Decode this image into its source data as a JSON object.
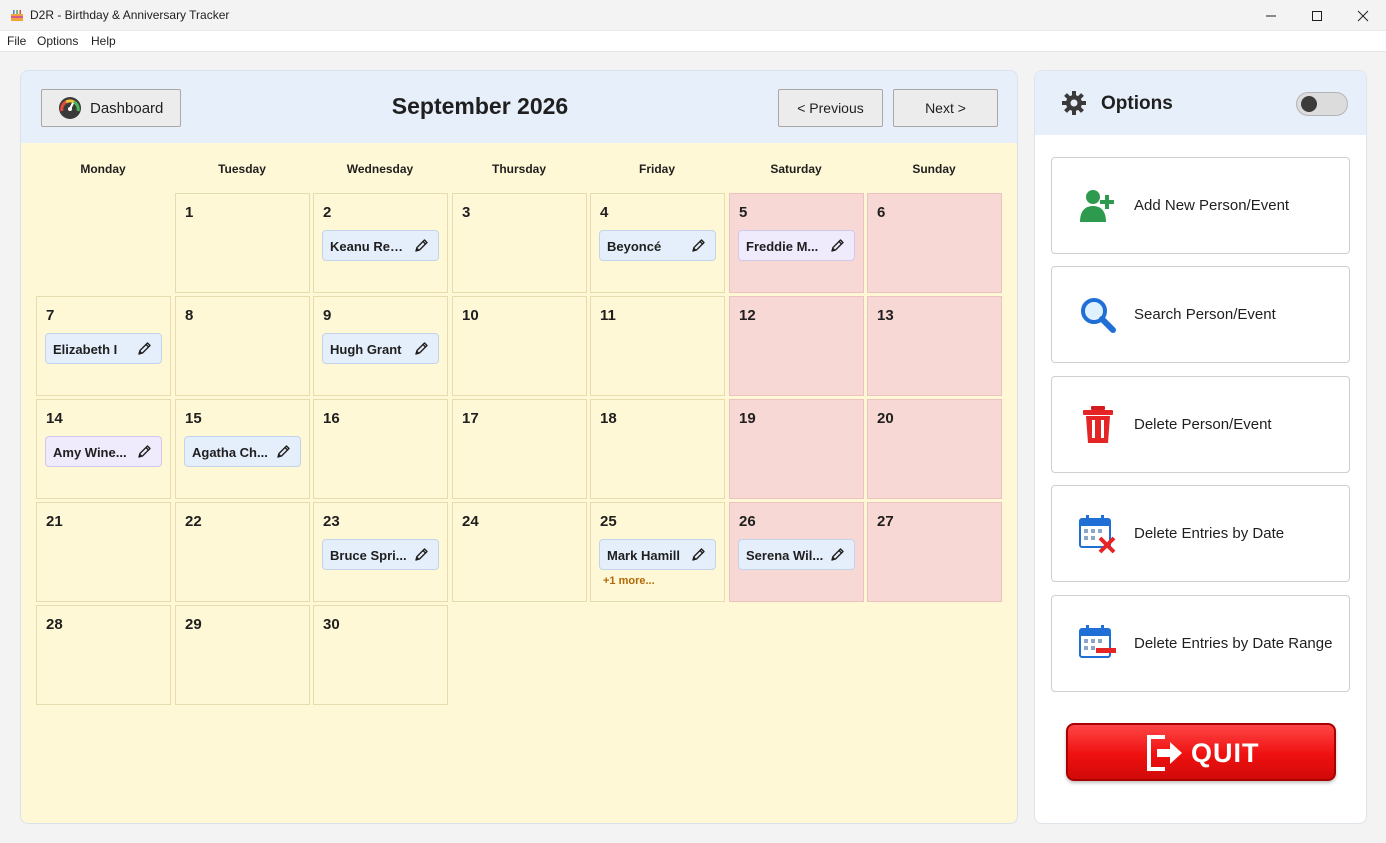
{
  "window": {
    "title": "D2R - Birthday & Anniversary Tracker",
    "controls": [
      "minimize",
      "maximize",
      "close"
    ]
  },
  "menu": {
    "items": [
      {
        "label": "File"
      },
      {
        "label": "Options"
      },
      {
        "label": "Help"
      }
    ]
  },
  "calendar": {
    "dashboard_label": "Dashboard",
    "month_title": "September 2026",
    "prev_label": "< Previous",
    "next_label": "Next >",
    "weekdays": [
      "Monday",
      "Tuesday",
      "Wednesday",
      "Thursday",
      "Friday",
      "Saturday",
      "Sunday"
    ],
    "first_weekday_index": 1,
    "days_in_month": 30,
    "weekend_color": "#f8d8d4",
    "weekday_color": "#fff8d6",
    "events": [
      {
        "day": 2,
        "name": "Keanu Ree...",
        "style": "default"
      },
      {
        "day": 4,
        "name": "Beyoncé",
        "style": "default"
      },
      {
        "day": 5,
        "name": "Freddie M...",
        "style": "alt"
      },
      {
        "day": 7,
        "name": "Elizabeth I",
        "style": "default"
      },
      {
        "day": 9,
        "name": "Hugh Grant",
        "style": "default"
      },
      {
        "day": 14,
        "name": "Amy Wine...",
        "style": "alt"
      },
      {
        "day": 15,
        "name": "Agatha Ch...",
        "style": "default"
      },
      {
        "day": 23,
        "name": "Bruce Spri...",
        "style": "default"
      },
      {
        "day": 25,
        "name": "Mark Hamill",
        "style": "default",
        "more": "+1 more..."
      },
      {
        "day": 26,
        "name": "Serena Wil...",
        "style": "default"
      }
    ]
  },
  "options": {
    "title": "Options",
    "toggle_on": false,
    "buttons": [
      {
        "label": "Add New Person/Event",
        "icon": "add-person-icon"
      },
      {
        "label": "Search Person/Event",
        "icon": "search-icon"
      },
      {
        "label": "Delete Person/Event",
        "icon": "trash-icon"
      },
      {
        "label": "Delete Entries by Date",
        "icon": "calendar-delete-icon"
      },
      {
        "label": "Delete Entries by Date Range",
        "icon": "calendar-range-delete-icon"
      }
    ],
    "quit_label": "QUIT",
    "quit_color": "#ef1010"
  }
}
